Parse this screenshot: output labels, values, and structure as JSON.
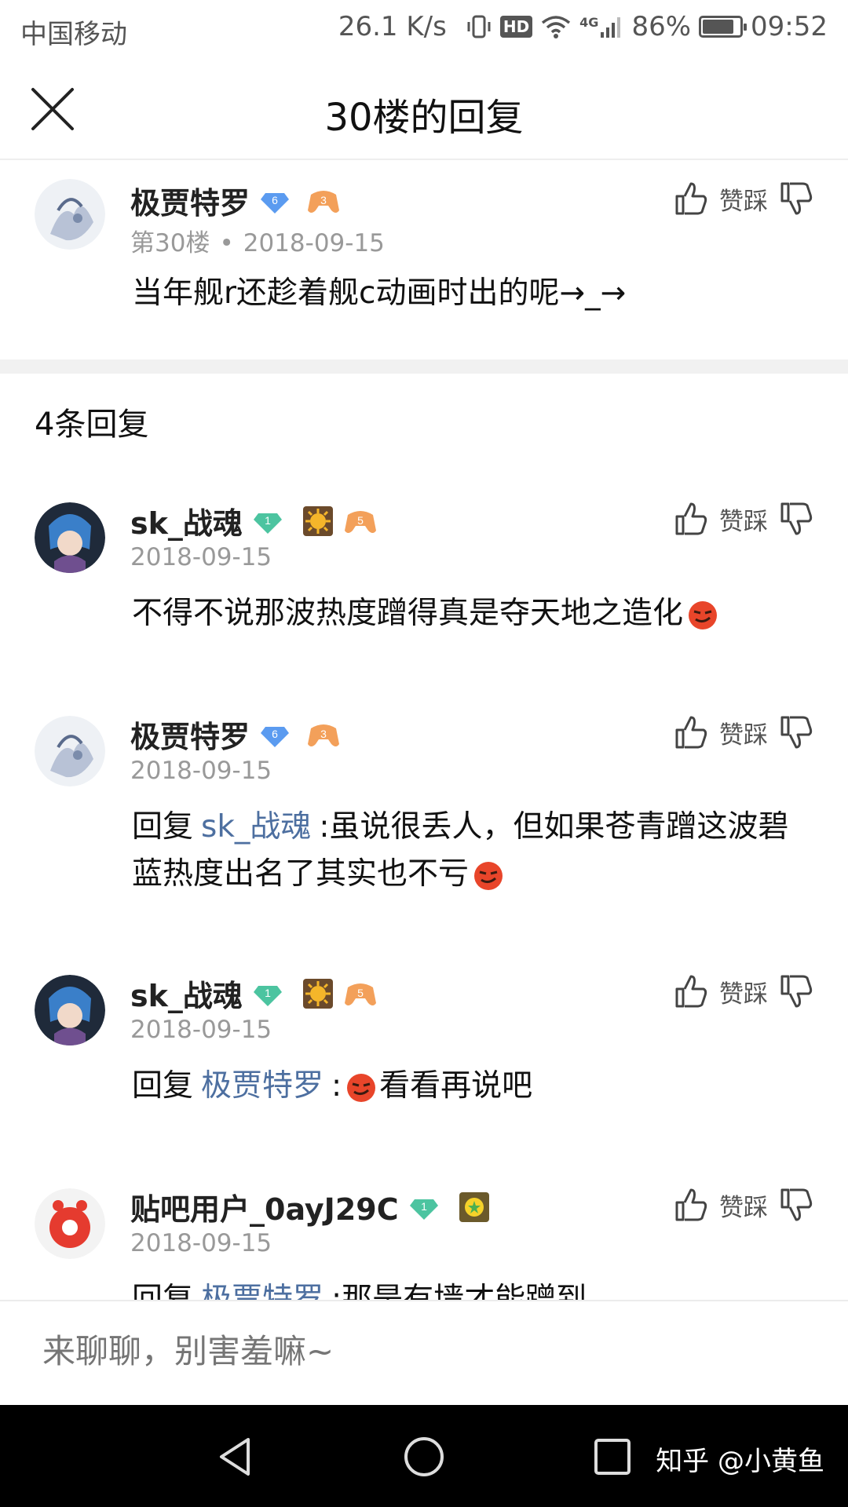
{
  "status_bar": {
    "carrier": "中国移动",
    "speed": "26.1 K/s",
    "hd": "HD",
    "network": "4G",
    "battery": "86%",
    "battery_level": 0.86,
    "time": "09:52"
  },
  "header": {
    "title": "30楼的回复",
    "close_icon": "close-icon"
  },
  "main_post": {
    "username": "极贾特罗",
    "level": "6",
    "game_level": "3",
    "floor": "第30楼",
    "date": "2018-09-15",
    "content": "当年舰r还趁着舰c动画时出的呢→_→",
    "vote_label": "赞踩"
  },
  "reply_count": "4条回复",
  "replies": [
    {
      "username": "sk_战魂",
      "level": "1",
      "game_level": "5",
      "date": "2018-09-15",
      "content": "不得不说那波热度蹭得真是夺天地之造化",
      "vote_label": "赞踩"
    },
    {
      "username": "极贾特罗",
      "level": "6",
      "game_level": "3",
      "date": "2018-09-15",
      "reply_prefix": "回复",
      "mention": "sk_战魂",
      "content": ":虽说很丢人，但如果苍青蹭这波碧蓝热度出名了其实也不亏",
      "vote_label": "赞踩"
    },
    {
      "username": "sk_战魂",
      "level": "1",
      "game_level": "5",
      "date": "2018-09-15",
      "reply_prefix": "回复",
      "mention": "极贾特罗",
      "content_before": ":",
      "content_after": "看看再说吧",
      "vote_label": "赞踩"
    },
    {
      "username": "贴吧用户_0ayJ29C",
      "level": "1",
      "date": "2018-09-15",
      "reply_prefix": "回复",
      "mention": "极贾特罗",
      "content": ":那是有墙才能蹭到",
      "vote_label": "赞踩"
    }
  ],
  "input": {
    "placeholder": "来聊聊，别害羞嘛~"
  },
  "nav": {
    "watermark": "知乎 @小黄鱼"
  }
}
